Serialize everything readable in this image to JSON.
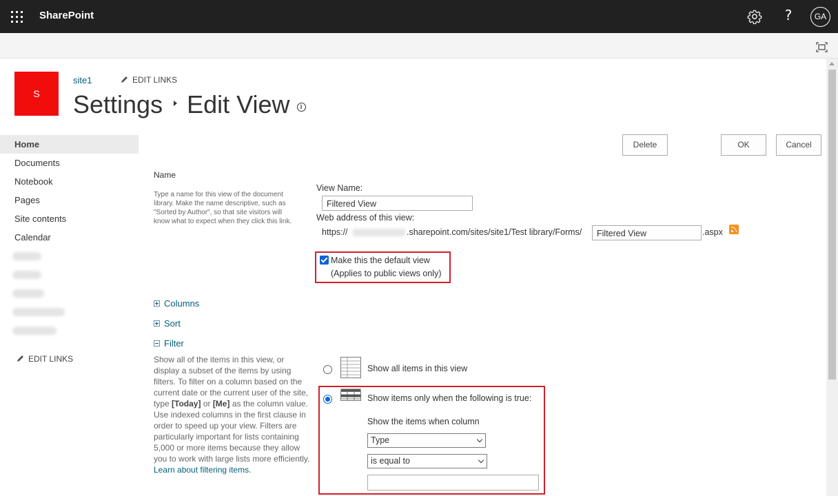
{
  "suitebar": {
    "brand": "SharePoint",
    "help": "?",
    "avatar": "GA"
  },
  "site": {
    "logo_letter": "S",
    "link": "site1",
    "edit_links": "EDIT LINKS"
  },
  "title": {
    "part1": "Settings",
    "part2": "Edit View"
  },
  "leftnav": {
    "items": [
      "Home",
      "Documents",
      "Notebook",
      "Pages",
      "Site contents",
      "Calendar"
    ],
    "edit_links": "EDIT LINKS"
  },
  "buttons": {
    "delete": "Delete",
    "ok": "OK",
    "cancel": "Cancel"
  },
  "name_section": {
    "heading": "Name",
    "description": "Type a name for this view of the document library. Make the name descriptive, such as \"Sorted by Author\", so that site visitors will know what to expect when they click this link.",
    "view_name_label": "View Name:",
    "view_name_value": "Filtered View",
    "web_address_label": "Web address of this view:",
    "url_prefix": "https://",
    "url_mid": ".sharepoint.com/sites/site1/Test library/Forms/",
    "url_value": "Filtered View",
    "url_suffix": ".aspx",
    "default_view_label": "Make this the default view",
    "default_view_note": "(Applies to public views only)",
    "default_view_checked": true
  },
  "sections": {
    "columns": "Columns",
    "sort": "Sort",
    "filter": "Filter"
  },
  "filter": {
    "desc_1": "Show all of the items in this view, or display a subset of the items by using filters. To filter on a column based on the current date or the current user of the site, type ",
    "today": "[Today]",
    "or": " or ",
    "me": "[Me]",
    "desc_2": " as the column value. Use indexed columns in the first clause in order to speed up your view. Filters are particularly important for lists containing 5,000 or more items because they allow you to work with large lists more efficiently. ",
    "learn": "Learn about filtering items.",
    "opt_all": "Show all items in this view",
    "opt_conditional": "Show items only when the following is true:",
    "column_label": "Show the items when column",
    "column_value": "Type",
    "operator_value": "is equal to",
    "value": "",
    "selected": "conditional"
  },
  "colors": {
    "suitebar": "#212121",
    "logo": "#f20d0d",
    "link": "#035e7a",
    "highlight": "#d0202a",
    "accent": "#0a64d6"
  }
}
